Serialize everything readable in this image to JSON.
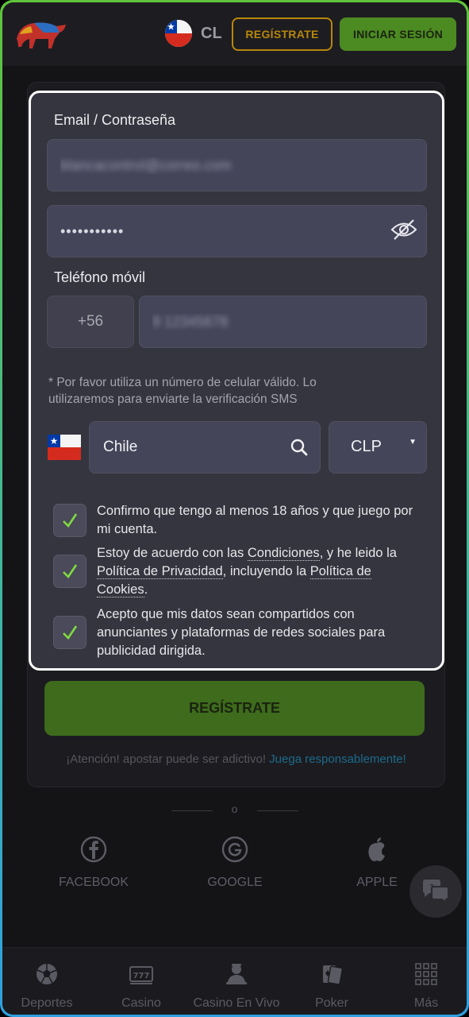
{
  "header": {
    "country_code": "CL",
    "register_label": "REGÍSTRATE",
    "login_label": "INICIAR SESIÓN"
  },
  "form": {
    "email_password_label": "Email / Contraseña",
    "email_value": "blancacontrol@correo.com",
    "password_value": "•••••••••••",
    "phone_label": "Teléfono móvil",
    "phone_code": "+56",
    "phone_value": "9 12345678",
    "phone_note": "* Por favor utiliza un número de celular válido. Lo utilizaremos para enviarte la verificación SMS",
    "country_value": "Chile",
    "currency_value": "CLP",
    "checks": [
      {
        "text": "Confirmo que tengo al menos 18 años y que juego por mi cuenta.",
        "checked": true
      },
      {
        "part1": "Estoy de acuerdo con las ",
        "link1": "Condiciones",
        "part2": ", y he leido la ",
        "link2": "Política de Privacidad",
        "part3": ", incluyendo la ",
        "link3": "Política de Cookies",
        "part4": ".",
        "checked": true
      },
      {
        "text": "Acepto que mis datos sean compartidos con anunciantes y plataformas de redes sociales para publicidad dirigida.",
        "checked": true
      }
    ]
  },
  "register_button": "REGÍSTRATE",
  "warning": {
    "text": "¡Atención! apostar puede ser adictivo! ",
    "link": "Juega responsablemente!"
  },
  "divider_text": "o",
  "social": [
    {
      "label": "FACEBOOK",
      "icon": "facebook-icon"
    },
    {
      "label": "GOOGLE",
      "icon": "google-icon"
    },
    {
      "label": "APPLE",
      "icon": "apple-icon"
    }
  ],
  "bottom_nav": [
    {
      "label": "Deportes",
      "icon": "soccer-ball-icon"
    },
    {
      "label": "Casino",
      "icon": "slot-machine-icon"
    },
    {
      "label": "Casino En Vivo",
      "icon": "live-dealer-icon"
    },
    {
      "label": "Poker",
      "icon": "cards-icon"
    },
    {
      "label": "Más",
      "icon": "grid-icon"
    }
  ],
  "colors": {
    "accent_green": "#4c8a22",
    "accent_gold": "#b8860b",
    "link_blue": "#1c6a8a",
    "check_green": "#7fdc3f"
  }
}
